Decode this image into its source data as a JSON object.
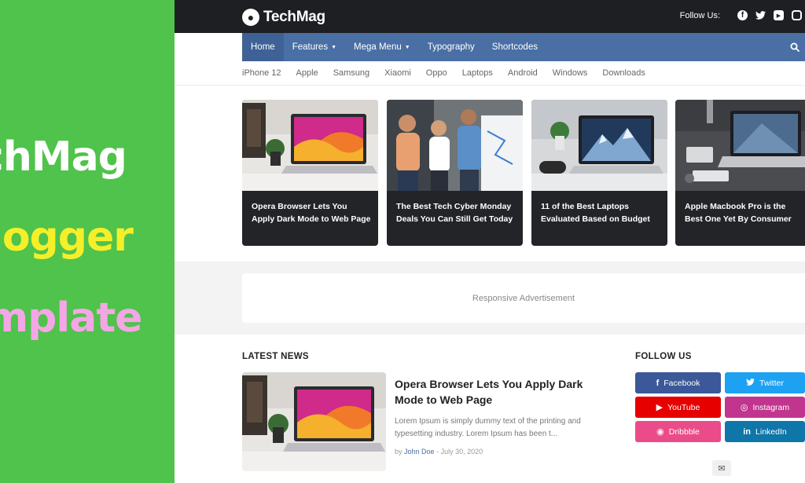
{
  "promo": {
    "line1": "chMag",
    "line2": "logger",
    "line3": "mplate"
  },
  "header": {
    "logo_text": "TechMag",
    "follow_label": "Follow Us:",
    "social_icons": [
      "facebook-icon",
      "twitter-icon",
      "youtube-icon",
      "instagram-icon"
    ]
  },
  "nav": {
    "items": [
      {
        "label": "Home",
        "active": true,
        "dropdown": false
      },
      {
        "label": "Features",
        "active": false,
        "dropdown": true
      },
      {
        "label": "Mega Menu",
        "active": false,
        "dropdown": true
      },
      {
        "label": "Typography",
        "active": false,
        "dropdown": false
      },
      {
        "label": "Shortcodes",
        "active": false,
        "dropdown": false
      }
    ],
    "search_icon": "search-icon"
  },
  "subnav": {
    "items": [
      "iPhone 12",
      "Apple",
      "Samsung",
      "Xiaomi",
      "Oppo",
      "Laptops",
      "Android",
      "Windows",
      "Downloads"
    ]
  },
  "featured": [
    {
      "title": "Opera Browser Lets You Apply Dark Mode to Web Page"
    },
    {
      "title": "The Best Tech Cyber Monday Deals You Can Still Get Today"
    },
    {
      "title": "11 of the Best Laptops Evaluated Based on Budget"
    },
    {
      "title": "Apple Macbook Pro is the Best One Yet By Consumer"
    }
  ],
  "ad": {
    "label": "Responsive Advertisement"
  },
  "latest": {
    "heading": "LATEST NEWS",
    "post": {
      "title": "Opera Browser Lets You Apply Dark Mode to Web Page",
      "excerpt": "Lorem Ipsum is simply dummy text of the printing and typesetting industry. Lorem Ipsum has been t...",
      "by": "by",
      "author": "John Doe",
      "date": "- July 30, 2020"
    }
  },
  "follow": {
    "heading": "FOLLOW US",
    "buttons": [
      {
        "label": "Facebook",
        "icon": "facebook-icon",
        "color": "#3b5998"
      },
      {
        "label": "Twitter",
        "icon": "twitter-icon",
        "color": "#1da1f2"
      },
      {
        "label": "YouTube",
        "icon": "youtube-icon",
        "color": "#e60000"
      },
      {
        "label": "Instagram",
        "icon": "instagram-icon",
        "color": "#c1358e"
      },
      {
        "label": "Dribbble",
        "icon": "dribbble-icon",
        "color": "#ea4c89"
      },
      {
        "label": "LinkedIn",
        "icon": "linkedin-icon",
        "color": "#0e76a8"
      }
    ]
  },
  "colors": {
    "topbar": "#1d1f22",
    "nav": "#4a6fa5",
    "promo": "#4fc34b",
    "card": "#222428"
  }
}
